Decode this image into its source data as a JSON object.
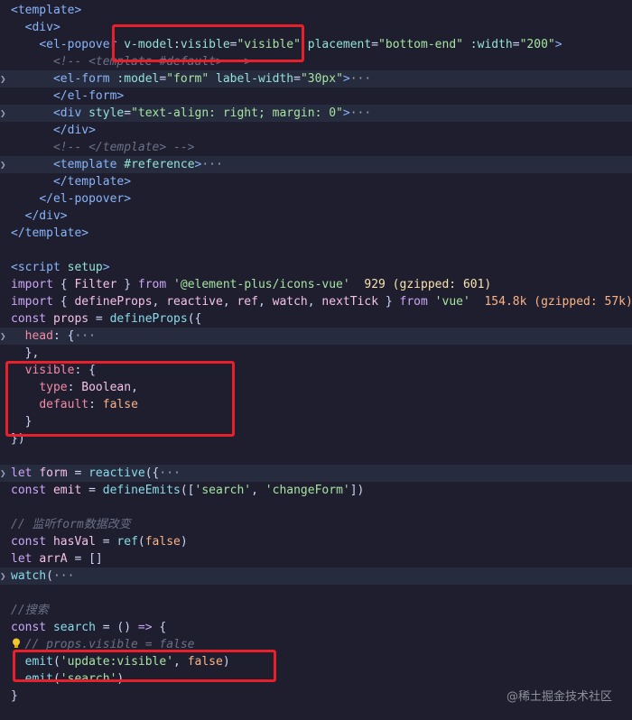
{
  "lines": [
    {
      "segs": [
        [
          "t-tag",
          "<template>"
        ]
      ]
    },
    {
      "segs": [
        [
          "t-punct",
          "  "
        ],
        [
          "t-tag",
          "<div>"
        ]
      ]
    },
    {
      "segs": [
        [
          "t-punct",
          "    "
        ],
        [
          "t-tag",
          "<el-popover "
        ],
        [
          "t-attr",
          "v-model"
        ],
        [
          "t-punct",
          ":"
        ],
        [
          "t-attr",
          "visible"
        ],
        [
          "t-punct",
          "="
        ],
        [
          "t-str",
          "\"visible\""
        ],
        [
          "t-punct",
          " "
        ],
        [
          "t-attr",
          "placement"
        ],
        [
          "t-punct",
          "="
        ],
        [
          "t-str",
          "\"bottom-end\""
        ],
        [
          "t-punct",
          " "
        ],
        [
          "t-attr",
          ":width"
        ],
        [
          "t-punct",
          "="
        ],
        [
          "t-str",
          "\"200\""
        ],
        [
          "t-tag",
          ">"
        ]
      ]
    },
    {
      "segs": [
        [
          "t-punct",
          "      "
        ],
        [
          "t-comment",
          "<!-- <template #default> -->"
        ]
      ]
    },
    {
      "fold": true,
      "hl": true,
      "segs": [
        [
          "t-punct",
          "      "
        ],
        [
          "t-tag",
          "<el-form "
        ],
        [
          "t-attr",
          ":model"
        ],
        [
          "t-punct",
          "="
        ],
        [
          "t-str",
          "\"form\""
        ],
        [
          "t-punct",
          " "
        ],
        [
          "t-attr",
          "label-width"
        ],
        [
          "t-punct",
          "="
        ],
        [
          "t-str",
          "\"30px\""
        ],
        [
          "t-tag",
          ">"
        ],
        [
          "ellipsis",
          "···"
        ]
      ]
    },
    {
      "segs": [
        [
          "t-punct",
          "      "
        ],
        [
          "t-tag",
          "</el-form>"
        ]
      ]
    },
    {
      "fold": true,
      "hl": true,
      "segs": [
        [
          "t-punct",
          "      "
        ],
        [
          "t-tag",
          "<div "
        ],
        [
          "t-attr",
          "style"
        ],
        [
          "t-punct",
          "="
        ],
        [
          "t-str",
          "\"text-align: right; margin: 0\""
        ],
        [
          "t-tag",
          ">"
        ],
        [
          "ellipsis",
          "···"
        ]
      ]
    },
    {
      "segs": [
        [
          "t-punct",
          "      "
        ],
        [
          "t-tag",
          "</div>"
        ]
      ]
    },
    {
      "segs": [
        [
          "t-punct",
          "      "
        ],
        [
          "t-comment",
          "<!-- </template> -->"
        ]
      ]
    },
    {
      "fold": true,
      "hl": true,
      "segs": [
        [
          "t-punct",
          "      "
        ],
        [
          "t-tag",
          "<template "
        ],
        [
          "t-attr",
          "#reference"
        ],
        [
          "t-tag",
          ">"
        ],
        [
          "ellipsis",
          "···"
        ]
      ]
    },
    {
      "segs": [
        [
          "t-punct",
          "      "
        ],
        [
          "t-tag",
          "</template>"
        ]
      ]
    },
    {
      "segs": [
        [
          "t-punct",
          "    "
        ],
        [
          "t-tag",
          "</el-popover>"
        ]
      ]
    },
    {
      "segs": [
        [
          "t-punct",
          "  "
        ],
        [
          "t-tag",
          "</div>"
        ]
      ]
    },
    {
      "segs": [
        [
          "t-tag",
          "</template>"
        ]
      ]
    },
    {
      "segs": []
    },
    {
      "segs": [
        [
          "t-tag",
          "<script "
        ],
        [
          "t-attr",
          "setup"
        ],
        [
          "t-tag",
          ">"
        ]
      ]
    },
    {
      "segs": [
        [
          "t-key",
          "import"
        ],
        [
          "t-punct",
          " { "
        ],
        [
          "t-var",
          "Filter"
        ],
        [
          "t-punct",
          " } "
        ],
        [
          "t-key",
          "from"
        ],
        [
          "t-punct",
          " "
        ],
        [
          "t-str",
          "'@element-plus/icons-vue'"
        ],
        [
          "t-punct",
          "  "
        ],
        [
          "t-hint",
          "929 (gzipped: 601)"
        ]
      ]
    },
    {
      "segs": [
        [
          "t-key",
          "import"
        ],
        [
          "t-punct",
          " { "
        ],
        [
          "t-var",
          "defineProps"
        ],
        [
          "t-punct",
          ", "
        ],
        [
          "t-var",
          "reactive"
        ],
        [
          "t-punct",
          ", "
        ],
        [
          "t-var",
          "ref"
        ],
        [
          "t-punct",
          ", "
        ],
        [
          "t-var",
          "watch"
        ],
        [
          "t-punct",
          ", "
        ],
        [
          "t-var",
          "nextTick"
        ],
        [
          "t-punct",
          " } "
        ],
        [
          "t-key",
          "from"
        ],
        [
          "t-punct",
          " "
        ],
        [
          "t-str",
          "'vue'"
        ],
        [
          "t-punct",
          "  "
        ],
        [
          "t-num",
          "154.8k (gzipped: 57k)"
        ]
      ]
    },
    {
      "segs": [
        [
          "t-key",
          "const"
        ],
        [
          "t-punct",
          " "
        ],
        [
          "t-var",
          "props"
        ],
        [
          "t-punct",
          " = "
        ],
        [
          "t-fn",
          "defineProps"
        ],
        [
          "t-punct",
          "({"
        ]
      ]
    },
    {
      "fold": true,
      "hl": true,
      "segs": [
        [
          "t-punct",
          "  "
        ],
        [
          "t-prop",
          "head"
        ],
        [
          "t-punct",
          ": {"
        ],
        [
          "ellipsis",
          "···"
        ]
      ]
    },
    {
      "segs": [
        [
          "t-punct",
          "  },"
        ]
      ]
    },
    {
      "segs": [
        [
          "t-punct",
          "  "
        ],
        [
          "t-prop",
          "visible"
        ],
        [
          "t-punct",
          ": {"
        ]
      ]
    },
    {
      "segs": [
        [
          "t-punct",
          "    "
        ],
        [
          "t-prop",
          "type"
        ],
        [
          "t-punct",
          ": "
        ],
        [
          "t-var",
          "Boolean"
        ],
        [
          "t-punct",
          ","
        ]
      ]
    },
    {
      "segs": [
        [
          "t-punct",
          "    "
        ],
        [
          "t-prop",
          "default"
        ],
        [
          "t-punct",
          ": "
        ],
        [
          "t-bool",
          "false"
        ]
      ]
    },
    {
      "segs": [
        [
          "t-punct",
          "  }"
        ]
      ]
    },
    {
      "segs": [
        [
          "t-punct",
          "})"
        ]
      ]
    },
    {
      "segs": []
    },
    {
      "fold": true,
      "hl": true,
      "segs": [
        [
          "t-key",
          "let"
        ],
        [
          "t-punct",
          " "
        ],
        [
          "t-var",
          "form"
        ],
        [
          "t-punct",
          " = "
        ],
        [
          "t-fn",
          "reactive"
        ],
        [
          "t-punct",
          "({"
        ],
        [
          "ellipsis",
          "···"
        ]
      ]
    },
    {
      "segs": [
        [
          "t-key",
          "const"
        ],
        [
          "t-punct",
          " "
        ],
        [
          "t-var",
          "emit"
        ],
        [
          "t-punct",
          " = "
        ],
        [
          "t-fn",
          "defineEmits"
        ],
        [
          "t-punct",
          "(["
        ],
        [
          "t-str",
          "'search'"
        ],
        [
          "t-punct",
          ", "
        ],
        [
          "t-str",
          "'changeForm'"
        ],
        [
          "t-punct",
          "])"
        ]
      ]
    },
    {
      "segs": []
    },
    {
      "segs": [
        [
          "t-comment",
          "// 监听form数据改变"
        ]
      ]
    },
    {
      "segs": [
        [
          "t-key",
          "const"
        ],
        [
          "t-punct",
          " "
        ],
        [
          "t-var",
          "hasVal"
        ],
        [
          "t-punct",
          " = "
        ],
        [
          "t-fn",
          "ref"
        ],
        [
          "t-punct",
          "("
        ],
        [
          "t-bool",
          "false"
        ],
        [
          "t-punct",
          ")"
        ]
      ]
    },
    {
      "segs": [
        [
          "t-key",
          "let"
        ],
        [
          "t-punct",
          " "
        ],
        [
          "t-var",
          "arrA"
        ],
        [
          "t-punct",
          " = []"
        ]
      ]
    },
    {
      "fold": true,
      "hl": true,
      "segs": [
        [
          "t-fn",
          "watch"
        ],
        [
          "t-punct",
          "("
        ],
        [
          "ellipsis",
          "···"
        ]
      ]
    },
    {
      "segs": []
    },
    {
      "segs": [
        [
          "t-comment",
          "//搜索"
        ]
      ]
    },
    {
      "segs": [
        [
          "t-key",
          "const"
        ],
        [
          "t-punct",
          " "
        ],
        [
          "t-fn",
          "search"
        ],
        [
          "t-punct",
          " = () "
        ],
        [
          "t-key",
          "=>"
        ],
        [
          "t-punct",
          " {"
        ]
      ]
    },
    {
      "segs": [
        [
          "t-punct",
          "  "
        ],
        [
          "t-comment",
          "// props.visible = false"
        ]
      ]
    },
    {
      "segs": [
        [
          "t-punct",
          "  "
        ],
        [
          "t-fn",
          "emit"
        ],
        [
          "t-punct",
          "("
        ],
        [
          "t-str",
          "'update:visible'"
        ],
        [
          "t-punct",
          ", "
        ],
        [
          "t-bool",
          "false"
        ],
        [
          "t-punct",
          ")"
        ]
      ]
    },
    {
      "segs": [
        [
          "t-punct",
          "  "
        ],
        [
          "t-fn",
          "emit"
        ],
        [
          "t-punct",
          "("
        ],
        [
          "t-str",
          "'search'"
        ],
        [
          "t-punct",
          ")"
        ]
      ]
    },
    {
      "segs": [
        [
          "t-punct",
          "}"
        ]
      ]
    }
  ],
  "watermark": "@稀土掘金技术社区"
}
